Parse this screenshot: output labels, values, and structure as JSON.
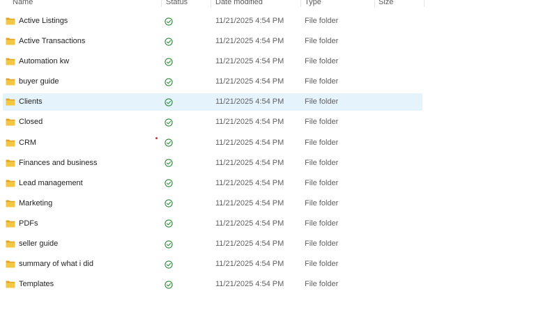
{
  "columns": {
    "name": "Name",
    "status": "Status",
    "date_modified": "Date modified",
    "type": "Type",
    "size": "Size"
  },
  "colors": {
    "folder": "#f3c744",
    "status_ok": "#2f8a3a",
    "selected_row": "#e5f3fd"
  },
  "rows": [
    {
      "name": "Active Listings",
      "status_icon": "sync-ok-icon",
      "date": "11/21/2025 4:54 PM",
      "type": "File folder"
    },
    {
      "name": "Active Transactions",
      "status_icon": "sync-ok-icon",
      "date": "11/21/2025 4:54 PM",
      "type": "File folder"
    },
    {
      "name": "Automation kw",
      "status_icon": "sync-ok-icon",
      "date": "11/21/2025 4:54 PM",
      "type": "File folder"
    },
    {
      "name": "buyer guide",
      "status_icon": "sync-ok-icon",
      "date": "11/21/2025 4:54 PM",
      "type": "File folder"
    },
    {
      "name": "Clients",
      "status_icon": "sync-ok-icon",
      "date": "11/21/2025 4:54 PM",
      "type": "File folder",
      "selected": true
    },
    {
      "name": "Closed",
      "status_icon": "sync-ok-icon",
      "date": "11/21/2025 4:54 PM",
      "type": "File folder"
    },
    {
      "name": "CRM",
      "status_icon": "sync-ok-icon",
      "date": "11/21/2025 4:54 PM",
      "type": "File folder"
    },
    {
      "name": "Finances and business",
      "status_icon": "sync-ok-icon",
      "date": "11/21/2025 4:54 PM",
      "type": "File folder"
    },
    {
      "name": "Lead management",
      "status_icon": "sync-ok-icon",
      "date": "11/21/2025 4:54 PM",
      "type": "File folder"
    },
    {
      "name": "Marketing",
      "status_icon": "sync-ok-icon",
      "date": "11/21/2025 4:54 PM",
      "type": "File folder"
    },
    {
      "name": "PDFs",
      "status_icon": "sync-ok-icon",
      "date": "11/21/2025 4:54 PM",
      "type": "File folder"
    },
    {
      "name": "seller guide",
      "status_icon": "sync-ok-icon",
      "date": "11/21/2025 4:54 PM",
      "type": "File folder"
    },
    {
      "name": "summary of what i did",
      "status_icon": "sync-ok-icon",
      "date": "11/21/2025 4:54 PM",
      "type": "File folder"
    },
    {
      "name": "Templates",
      "status_icon": "sync-ok-icon",
      "date": "11/21/2025 4:54 PM",
      "type": "File folder"
    }
  ]
}
